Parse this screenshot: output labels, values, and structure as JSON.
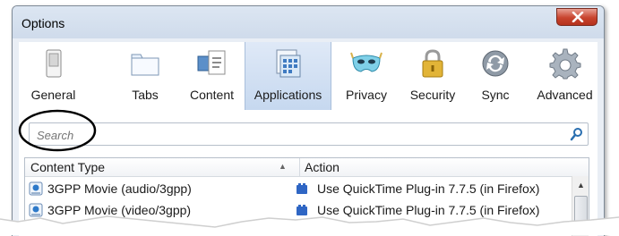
{
  "window": {
    "title": "Options"
  },
  "tabs": [
    {
      "label": "General",
      "icon": "switch-icon",
      "selected": false
    },
    {
      "label": "Tabs",
      "icon": "tabs-icon",
      "selected": false
    },
    {
      "label": "Content",
      "icon": "content-icon",
      "selected": false
    },
    {
      "label": "Applications",
      "icon": "applications-icon",
      "selected": true
    },
    {
      "label": "Privacy",
      "icon": "mask-icon",
      "selected": false
    },
    {
      "label": "Security",
      "icon": "padlock-icon",
      "selected": false
    },
    {
      "label": "Sync",
      "icon": "sync-icon",
      "selected": false
    },
    {
      "label": "Advanced",
      "icon": "gear-icon",
      "selected": false
    }
  ],
  "search": {
    "placeholder": "Search",
    "value": ""
  },
  "table": {
    "columns": [
      "Content Type",
      "Action"
    ],
    "rows": [
      {
        "type": "3GPP Movie (audio/3gpp)",
        "action": "Use QuickTime Plug-in 7.7.5 (in Firefox)"
      },
      {
        "type": "3GPP Movie (video/3gpp)",
        "action": "Use QuickTime Plug-in 7.7.5 (in Firefox)"
      }
    ]
  },
  "colors": {
    "selected_tab": "#c6d8ef",
    "close_button": "#c8432d",
    "annotation": "#000000"
  }
}
